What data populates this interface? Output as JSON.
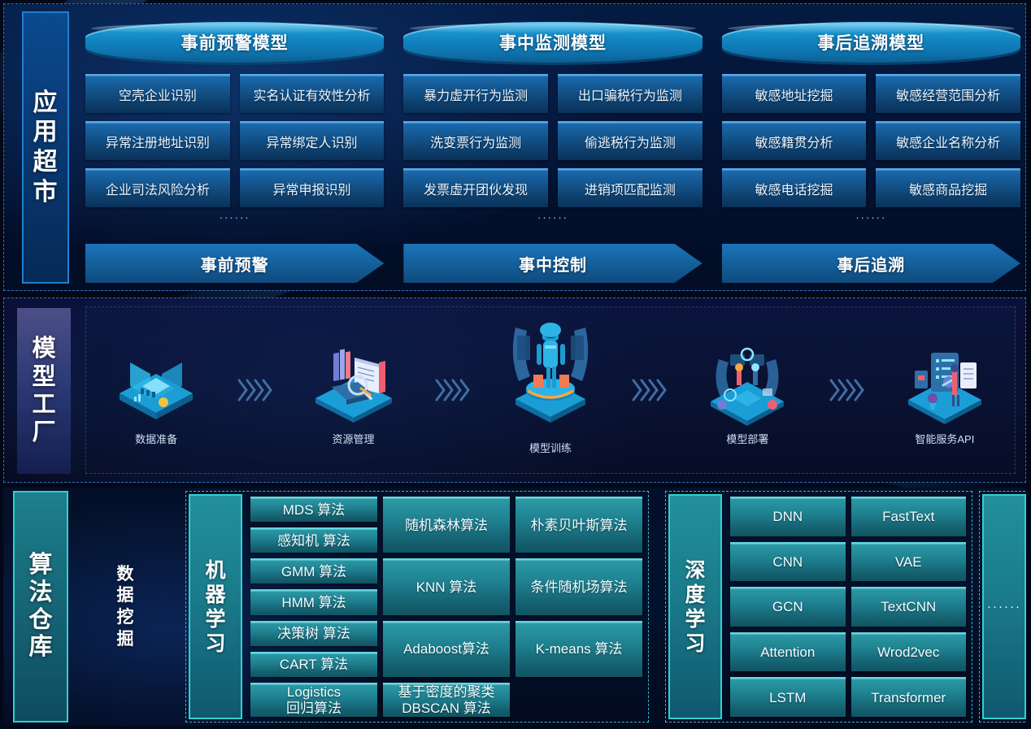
{
  "sections": {
    "app_market": {
      "label": "应用超市",
      "groups": [
        {
          "title": "事前预警模型",
          "cards": [
            "空壳企业识别",
            "实名认证有效性分析",
            "异常注册地址识别",
            "异常绑定人识别",
            "企业司法风险分析",
            "异常申报识别"
          ],
          "ellipsis": "······"
        },
        {
          "title": "事中监测模型",
          "cards": [
            "暴力虚开行为监测",
            "出口骗税行为监测",
            "洗变票行为监测",
            "偷逃税行为监测",
            "发票虚开团伙发现",
            "进销项匹配监测"
          ],
          "ellipsis": "······"
        },
        {
          "title": "事后追溯模型",
          "cards": [
            "敏感地址挖掘",
            "敏感经营范围分析",
            "敏感籍贯分析",
            "敏感企业名称分析",
            "敏感电话挖掘",
            "敏感商品挖掘"
          ],
          "ellipsis": "······"
        }
      ],
      "arrows": [
        "事前预警",
        "事中控制",
        "事后追溯"
      ]
    },
    "model_factory": {
      "label": "模型工厂",
      "stages": [
        {
          "name": "数据准备",
          "icon": "data-prep-icon"
        },
        {
          "name": "资源管理",
          "icon": "resource-manage-icon"
        },
        {
          "name": "模型训练",
          "icon": "model-training-icon"
        },
        {
          "name": "模型部署",
          "icon": "model-deploy-icon"
        },
        {
          "name": "智能服务API",
          "icon": "service-api-icon"
        }
      ]
    },
    "algorithm_warehouse": {
      "label": "算法仓库",
      "data_mining_label": "数据挖掘",
      "machine_learning": {
        "label": "机器学习",
        "column1": [
          "MDS 算法",
          "感知机 算法",
          "GMM 算法",
          "HMM 算法",
          "决策树 算法",
          "CART 算法"
        ],
        "column2": [
          "随机森林算法",
          "KNN 算法",
          "Adaboost算法",
          "Logistics\n回归算法"
        ],
        "column3": [
          "朴素贝叶斯算法",
          "条件随机场算法",
          "K-means 算法",
          "基于密度的聚类\nDBSCAN 算法"
        ]
      },
      "deep_learning": {
        "label": "深度学习",
        "column1": [
          "DNN",
          "CNN",
          "GCN",
          "Attention",
          "LSTM"
        ],
        "column2": [
          "FastText",
          "VAE",
          "TextCNN",
          "Wrod2vec",
          "Transformer"
        ]
      },
      "more": "······"
    }
  },
  "colors": {
    "accent_blue": "#1f7fd0",
    "accent_cyan": "#2fd0cf",
    "card_blue": "#14568f",
    "chip_teal": "#1f8190",
    "bg_dark": "#020817"
  }
}
